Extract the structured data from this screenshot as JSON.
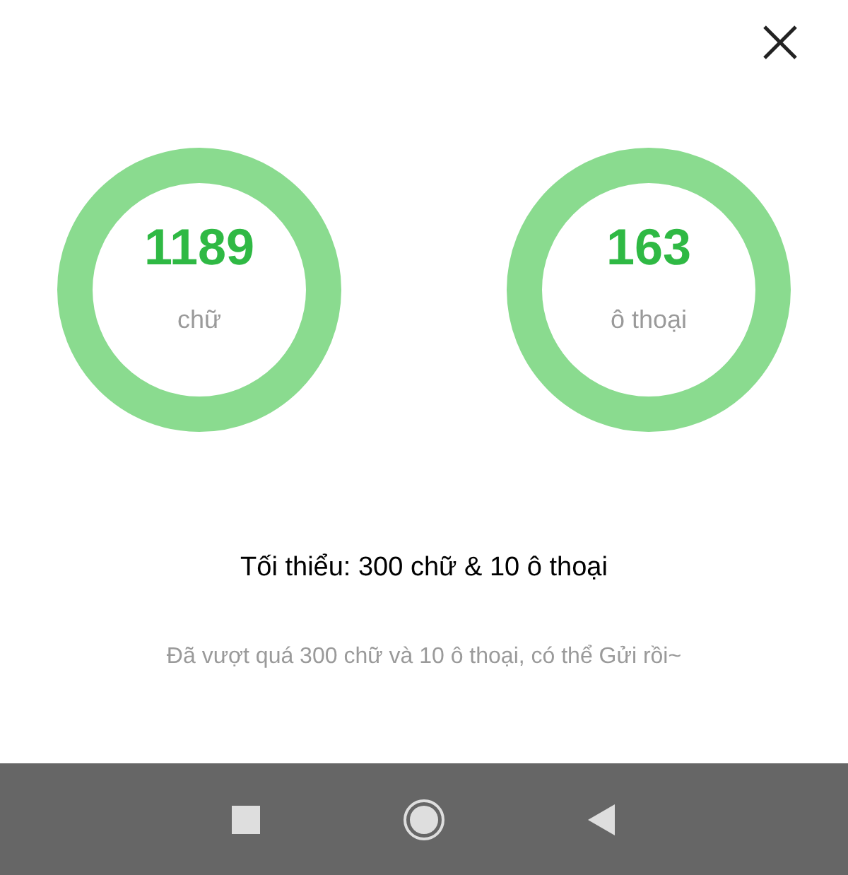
{
  "counters": [
    {
      "value": "1189",
      "label": "chữ",
      "level": 1
    },
    {
      "value": "163",
      "label": "ô thoại",
      "level": 1
    }
  ],
  "requirement": "Tối thiểu: 300 chữ & 10 ô thoại",
  "message": "Đã vượt quá 300 chữ và 10 ô thoại, có thể Gửi rồi~"
}
